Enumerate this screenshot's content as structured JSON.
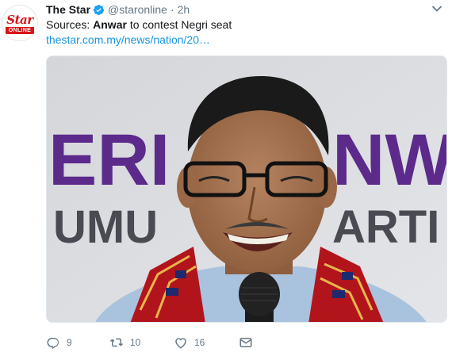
{
  "tweet": {
    "avatar": {
      "brand": "Star",
      "sub": "ONLINE"
    },
    "author_name": "The Star",
    "handle": "@staronline",
    "separator": "·",
    "time": "2h",
    "text_before": "Sources: ",
    "text_bold": "Anwar",
    "text_after": " to contest Negri seat",
    "link": "thestar.com.my/news/nation/20…",
    "image_alt_banner": [
      "ERI",
      "NW",
      "UMU",
      "ARTI"
    ],
    "actions": {
      "reply_count": "9",
      "retweet_count": "10",
      "like_count": "16"
    }
  },
  "colors": {
    "brand_red": "#d7141a",
    "link_blue": "#1b95e0",
    "verified_blue": "#1da1f2",
    "muted": "#657786"
  },
  "icons": [
    "verified-icon",
    "chevron-down-icon",
    "reply-icon",
    "retweet-icon",
    "like-icon",
    "message-icon"
  ]
}
